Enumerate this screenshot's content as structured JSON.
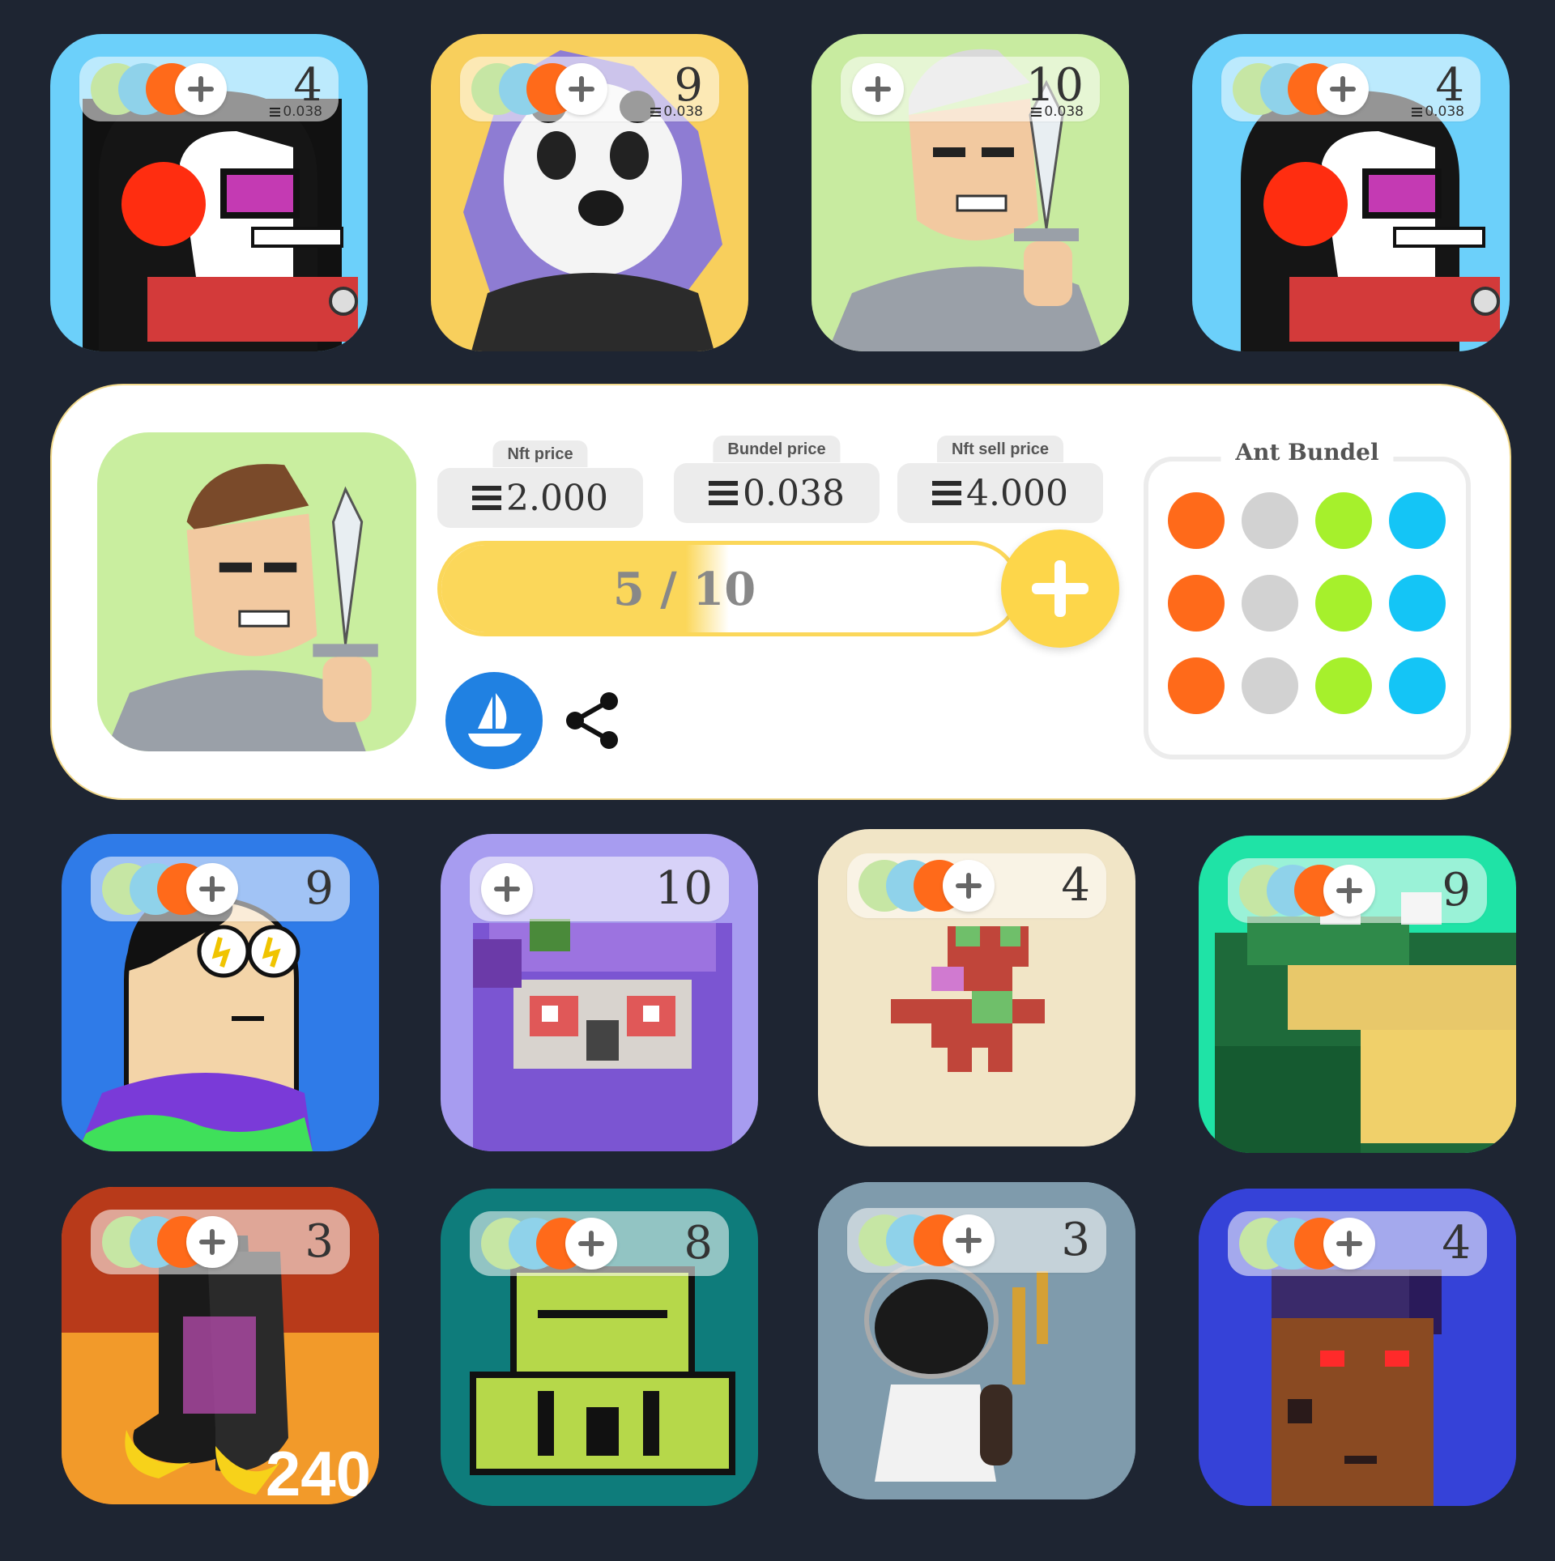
{
  "colors": {
    "background": "#1e2532",
    "accent_yellow": "#fdd64a",
    "bundle_orange": "#ff6a1a",
    "bundle_gray": "#d2d2d2",
    "bundle_green": "#a6f02c",
    "bundle_blue": "#14c5f6"
  },
  "top_cards": [
    {
      "count": "4",
      "price": "0.038",
      "bg": "#6cd0fa",
      "dots": [
        "green",
        "blue",
        "orange"
      ],
      "art": "punk-headphones"
    },
    {
      "count": "9",
      "price": "0.038",
      "bg": "#f8cf5c",
      "dots": [
        "green",
        "blue",
        "orange"
      ],
      "art": "panda-hedgehog"
    },
    {
      "count": "10",
      "price": "0.038",
      "bg": "#c8eba0",
      "dots": [],
      "art": "warrior-dagger"
    },
    {
      "count": "4",
      "price": "0.038",
      "bg": "#6cd0fa",
      "dots": [
        "green",
        "blue",
        "orange"
      ],
      "art": "punk-headphones"
    }
  ],
  "detail": {
    "nft_price_label": "Nft price",
    "nft_price": "2.000",
    "bundle_price_label": "Bundel price",
    "bundle_price": "0.038",
    "sell_price_label": "Nft sell price",
    "sell_price": "4.000",
    "progress_current": "5",
    "progress_total": "10",
    "progress_separator": "/",
    "progress_fraction": 0.5,
    "bundle_title": "Ant Bundel",
    "bundle_rows": [
      [
        "orange",
        "gray",
        "green",
        "blue"
      ],
      [
        "orange",
        "gray",
        "green",
        "blue"
      ],
      [
        "orange",
        "gray",
        "green",
        "blue"
      ]
    ],
    "icons": [
      "opensea-icon",
      "share-icon"
    ]
  },
  "row3_cards": [
    {
      "count": "9",
      "bg": "#2f7be8",
      "dots": [
        "green",
        "blue",
        "orange"
      ],
      "art": "cartoon-boy"
    },
    {
      "count": "10",
      "bg": "#a79cf0",
      "dots": [],
      "art": "pixel-owl"
    },
    {
      "count": "4",
      "bg": "#f1e5c6",
      "dots": [
        "green",
        "blue",
        "orange"
      ],
      "art": "pixel-flower"
    },
    {
      "count": "9",
      "bg": "#1fe3a6",
      "dots": [
        "green",
        "blue",
        "orange"
      ],
      "art": "pixel-croc"
    }
  ],
  "row4_cards": [
    {
      "count": "3",
      "bg": "#e4762a",
      "dots": [
        "green",
        "blue",
        "orange"
      ],
      "art": "socks"
    },
    {
      "count": "8",
      "bg": "#0e7c7b",
      "dots": [
        "green",
        "blue",
        "orange"
      ],
      "art": "pixel-frog"
    },
    {
      "count": "3",
      "bg": "#8aa7b8",
      "dots": [
        "green",
        "blue",
        "orange"
      ],
      "art": "astronaut"
    },
    {
      "count": "4",
      "bg": "#3b3fd6",
      "dots": [
        "green",
        "blue",
        "orange"
      ],
      "art": "pixel-punk"
    }
  ],
  "socks_text": "240"
}
